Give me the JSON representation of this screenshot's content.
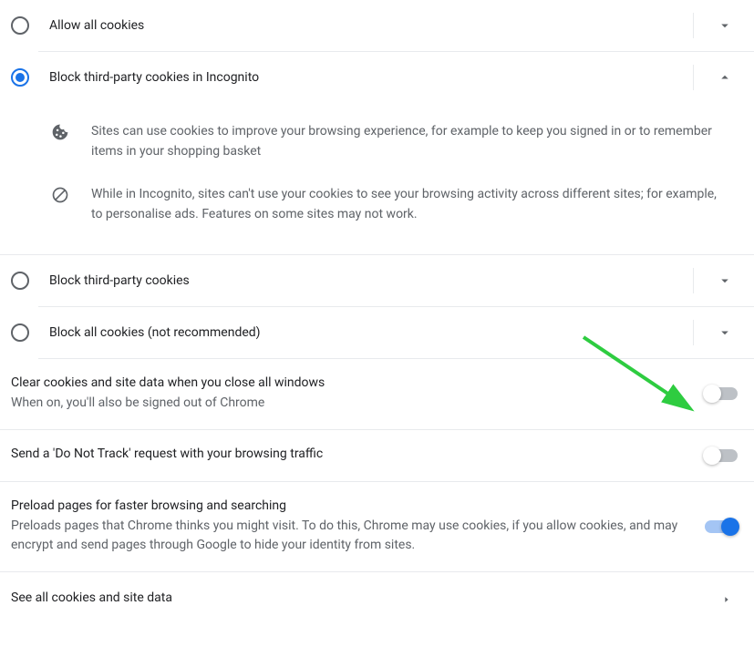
{
  "cookieOptions": {
    "allowAll": {
      "label": "Allow all cookies"
    },
    "blockThirdIncognito": {
      "label": "Block third-party cookies in Incognito"
    },
    "blockThird": {
      "label": "Block third-party cookies"
    },
    "blockAll": {
      "label": "Block all cookies (not recommended)"
    }
  },
  "incognitoDetails": {
    "line1": "Sites can use cookies to improve your browsing experience, for example to keep you signed in or to remember items in your shopping basket",
    "line2": "While in Incognito, sites can't use your cookies to see your browsing activity across different sites; for example, to personalise ads. Features on some sites may not work."
  },
  "settings": {
    "clearCookies": {
      "title": "Clear cookies and site data when you close all windows",
      "sub": "When on, you'll also be signed out of Chrome",
      "on": false
    },
    "dnt": {
      "title": "Send a 'Do Not Track' request with your browsing traffic",
      "on": false
    },
    "preload": {
      "title": "Preload pages for faster browsing and searching",
      "sub": "Preloads pages that Chrome thinks you might visit. To do this, Chrome may use cookies, if you allow cookies, and may encrypt and send pages through Google to hide your identity from sites.",
      "on": true
    },
    "seeAll": {
      "title": "See all cookies and site data"
    }
  }
}
